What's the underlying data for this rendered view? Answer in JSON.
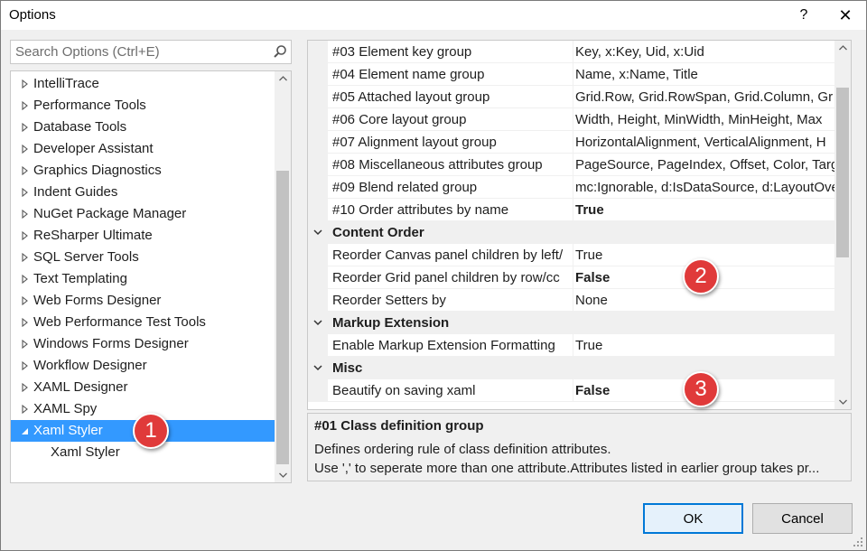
{
  "window": {
    "title": "Options",
    "help_label": "?",
    "close_label": "✕"
  },
  "search": {
    "placeholder": "Search Options (Ctrl+E)"
  },
  "tree": {
    "items": [
      {
        "label": "IntelliTrace",
        "state": "collapsed"
      },
      {
        "label": "Performance Tools",
        "state": "collapsed"
      },
      {
        "label": "Database Tools",
        "state": "collapsed"
      },
      {
        "label": "Developer Assistant",
        "state": "collapsed"
      },
      {
        "label": "Graphics Diagnostics",
        "state": "collapsed"
      },
      {
        "label": "Indent Guides",
        "state": "collapsed"
      },
      {
        "label": "NuGet Package Manager",
        "state": "collapsed"
      },
      {
        "label": "ReSharper Ultimate",
        "state": "collapsed"
      },
      {
        "label": "SQL Server Tools",
        "state": "collapsed"
      },
      {
        "label": "Text Templating",
        "state": "collapsed"
      },
      {
        "label": "Web Forms Designer",
        "state": "collapsed"
      },
      {
        "label": "Web Performance Test Tools",
        "state": "collapsed"
      },
      {
        "label": "Windows Forms Designer",
        "state": "collapsed"
      },
      {
        "label": "Workflow Designer",
        "state": "collapsed"
      },
      {
        "label": "XAML Designer",
        "state": "collapsed"
      },
      {
        "label": "XAML Spy",
        "state": "collapsed"
      },
      {
        "label": "Xaml Styler",
        "state": "expanded",
        "selected": true
      },
      {
        "label": "Xaml Styler",
        "state": "child"
      }
    ]
  },
  "grid": {
    "rows": [
      {
        "kind": "prop",
        "name": "#03 Element key group",
        "value": "Key, x:Key, Uid, x:Uid",
        "bold": false
      },
      {
        "kind": "prop",
        "name": "#04 Element name group",
        "value": "Name, x:Name, Title",
        "bold": false
      },
      {
        "kind": "prop",
        "name": "#05 Attached layout group",
        "value": "Grid.Row, Grid.RowSpan, Grid.Column, Gr",
        "bold": false
      },
      {
        "kind": "prop",
        "name": "#06 Core layout group",
        "value": "Width, Height, MinWidth, MinHeight, Max",
        "bold": false
      },
      {
        "kind": "prop",
        "name": "#07 Alignment layout group",
        "value": "HorizontalAlignment, VerticalAlignment, H",
        "bold": false
      },
      {
        "kind": "prop",
        "name": "#08 Miscellaneous attributes group",
        "value": "PageSource, PageIndex, Offset, Color, Targ",
        "bold": false
      },
      {
        "kind": "prop",
        "name": "#09 Blend related group",
        "value": "mc:Ignorable, d:IsDataSource, d:LayoutOve",
        "bold": false
      },
      {
        "kind": "prop",
        "name": "#10 Order attributes by name",
        "value": "True",
        "bold": true
      },
      {
        "kind": "category",
        "name": "Content Order"
      },
      {
        "kind": "prop",
        "name": "Reorder Canvas panel children by left/",
        "value": "True",
        "bold": false
      },
      {
        "kind": "prop",
        "name": "Reorder Grid panel children by row/cc",
        "value": "False",
        "bold": true
      },
      {
        "kind": "prop",
        "name": "Reorder Setters by",
        "value": "None",
        "bold": false
      },
      {
        "kind": "category",
        "name": "Markup Extension"
      },
      {
        "kind": "prop",
        "name": "Enable Markup Extension Formatting",
        "value": "True",
        "bold": false
      },
      {
        "kind": "category",
        "name": "Misc"
      },
      {
        "kind": "prop",
        "name": "Beautify on saving xaml",
        "value": "False",
        "bold": true
      }
    ]
  },
  "description": {
    "title": "#01 Class definition group",
    "line1": "Defines ordering rule of class definition attributes.",
    "line2": "Use ',' to seperate more than one attribute.Attributes listed in earlier group takes pr..."
  },
  "buttons": {
    "ok": "OK",
    "cancel": "Cancel"
  },
  "annotations": {
    "badge1": "1",
    "badge2": "2",
    "badge3": "3",
    "color": "#e03a3a"
  },
  "colors": {
    "selection": "#3399ff",
    "accent": "#0078d7"
  }
}
